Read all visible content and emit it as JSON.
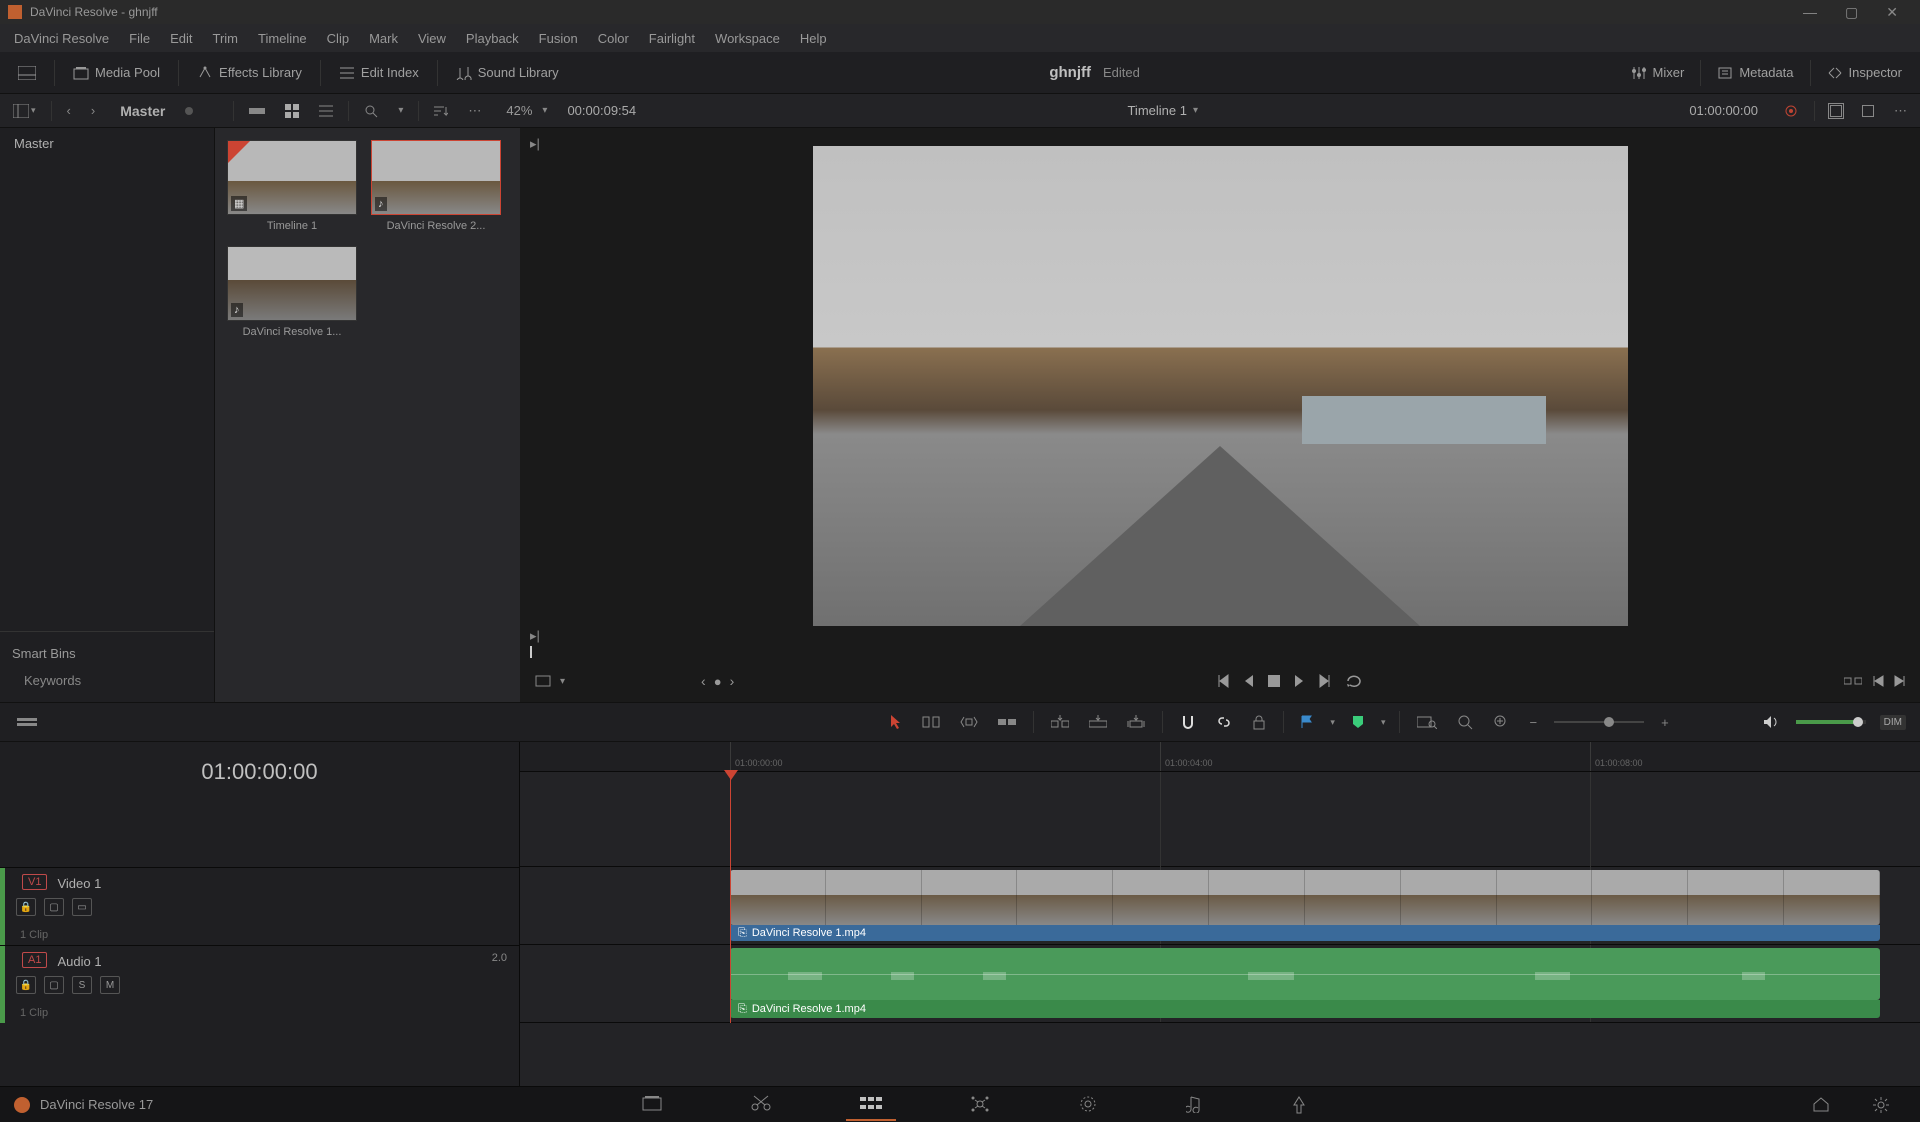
{
  "titlebar": {
    "app": "DaVinci Resolve",
    "project": "ghnjff"
  },
  "menu": [
    "DaVinci Resolve",
    "File",
    "Edit",
    "Trim",
    "Timeline",
    "Clip",
    "Mark",
    "View",
    "Playback",
    "Fusion",
    "Color",
    "Fairlight",
    "Workspace",
    "Help"
  ],
  "toolbar": {
    "media_pool": "Media Pool",
    "effects_library": "Effects Library",
    "edit_index": "Edit Index",
    "sound_library": "Sound Library",
    "project_title": "ghnjff",
    "project_status": "Edited",
    "mixer": "Mixer",
    "metadata": "Metadata",
    "inspector": "Inspector"
  },
  "secbar": {
    "master": "Master",
    "zoom": "42%",
    "source_tc": "00:00:09:54",
    "timeline_name": "Timeline 1",
    "record_tc": "01:00:00:00"
  },
  "sidebar": {
    "bin": "Master",
    "smart_bins": "Smart Bins",
    "keywords": "Keywords"
  },
  "thumbs": [
    {
      "label": "Timeline 1",
      "badge": "▦",
      "corner": true,
      "selected": false,
      "cls": "road-sky"
    },
    {
      "label": "DaVinci Resolve 2...",
      "badge": "♪",
      "corner": false,
      "selected": true,
      "cls": "road-sky"
    },
    {
      "label": "DaVinci Resolve 1...",
      "badge": "♪",
      "corner": false,
      "selected": false,
      "cls": "mountain"
    }
  ],
  "viewer": {
    "dim_label": "DIM"
  },
  "timeline": {
    "tc": "01:00:00:00",
    "ruler_marks": [
      "01:00:00:00",
      "01:00:04:00",
      "01:00:08:00"
    ],
    "video_track": {
      "id": "V1",
      "name": "Video 1",
      "clips": "1 Clip"
    },
    "audio_track": {
      "id": "A1",
      "name": "Audio 1",
      "db": "2.0",
      "clips": "1 Clip"
    },
    "clip_name": "DaVinci Resolve 1.mp4"
  },
  "footer": {
    "version": "DaVinci Resolve 17"
  }
}
